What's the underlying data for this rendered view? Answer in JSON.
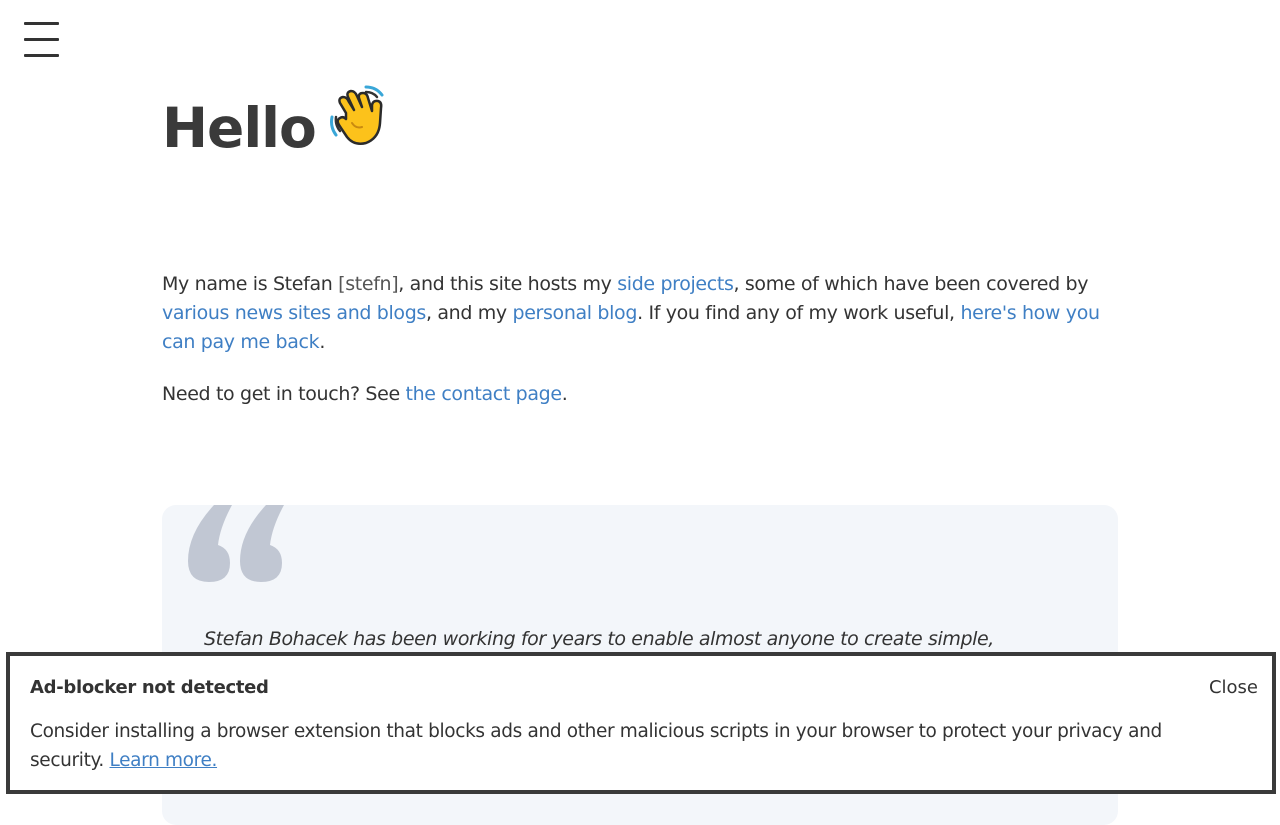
{
  "header": {
    "menu_icon": "hamburger-menu-icon"
  },
  "main": {
    "title": "Hello",
    "title_icon": "waving-hand-icon",
    "intro": {
      "t1": "My name is Stefan ",
      "phonetic": "[stefn]",
      "t2": ", and this site hosts my ",
      "link_side_projects": "side projects",
      "t3": ", some of which have been covered by ",
      "link_news": "various news sites and blogs",
      "t4": ", and my ",
      "link_blog": "personal blog",
      "t5": ". If you find any of my work useful, ",
      "link_pay": "here's how you can pay me back",
      "t6": "."
    },
    "contact": {
      "t1": "Need to get in touch? See ",
      "link_contact": "the contact page",
      "t2": "."
    },
    "quote": {
      "icon": "quote-mark-icon",
      "text": "Stefan Bohacek has been working for years to enable almost anyone to create simple,"
    }
  },
  "notice": {
    "title": "Ad-blocker not detected",
    "close_label": "Close",
    "body": "Consider installing a browser extension that blocks ads and other malicious scripts in your browser to protect your privacy and security. ",
    "learn_more": "Learn more."
  },
  "colors": {
    "link": "#3f7fc4",
    "text": "#333333",
    "quote_bg": "#f3f6fa",
    "quote_mark": "#c1c7d3",
    "notice_border": "#3a3a3a"
  }
}
